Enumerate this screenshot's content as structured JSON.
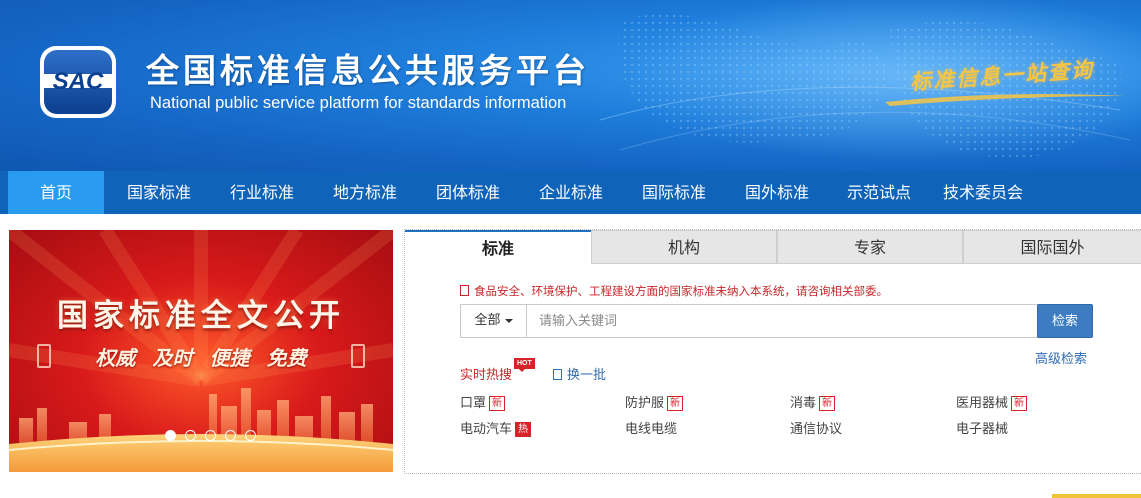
{
  "header": {
    "logo_text": "SAC",
    "title": "全国标准信息公共服务平台",
    "subtitle": "National public service platform  for standards information",
    "slogan": "标准信息一站查询"
  },
  "nav": {
    "items": [
      {
        "label": "首页",
        "active": true
      },
      {
        "label": "国家标准"
      },
      {
        "label": "行业标准"
      },
      {
        "label": "地方标准"
      },
      {
        "label": "团体标准"
      },
      {
        "label": "企业标准"
      },
      {
        "label": "国际标准"
      },
      {
        "label": "国外标准"
      },
      {
        "label": "示范试点"
      },
      {
        "label": "技术委员会"
      }
    ]
  },
  "carousel": {
    "title": "国家标准全文公开",
    "tags": [
      "权威",
      "及时",
      "便捷",
      "免费"
    ],
    "slide_count": 5,
    "active_slide": 1
  },
  "search_panel": {
    "tabs": [
      {
        "label": "标准",
        "active": true
      },
      {
        "label": "机构"
      },
      {
        "label": "专家"
      },
      {
        "label": "国际国外"
      }
    ],
    "notice": "食品安全、环境保护、工程建设方面的国家标准未纳入本系统，请咨询相关部委。",
    "scope": "全部",
    "placeholder": "请输入关键词",
    "search_button": "检索",
    "advanced_search": "高级检索",
    "hot_label": "实时热搜",
    "hot_badge": "HOT",
    "refresh_label": "换一批",
    "keywords": [
      {
        "text": "口罩",
        "badge": "新"
      },
      {
        "text": "防护服",
        "badge": "新"
      },
      {
        "text": "消毒",
        "badge": "新"
      },
      {
        "text": "医用器械",
        "badge": "新"
      },
      {
        "text": "电动汽车",
        "badge": "热"
      },
      {
        "text": "电线电缆",
        "badge": ""
      },
      {
        "text": "通信协议",
        "badge": ""
      },
      {
        "text": "电子器械",
        "badge": ""
      }
    ]
  },
  "colors": {
    "banner_blue": "#1f7fdc",
    "nav_blue": "#0f63b8",
    "nav_active": "#2a9cf0",
    "accent_red": "#c8262a",
    "link_blue": "#2f6db4",
    "button_blue": "#3d7cc0",
    "slogan_gold": "#f6c544"
  }
}
